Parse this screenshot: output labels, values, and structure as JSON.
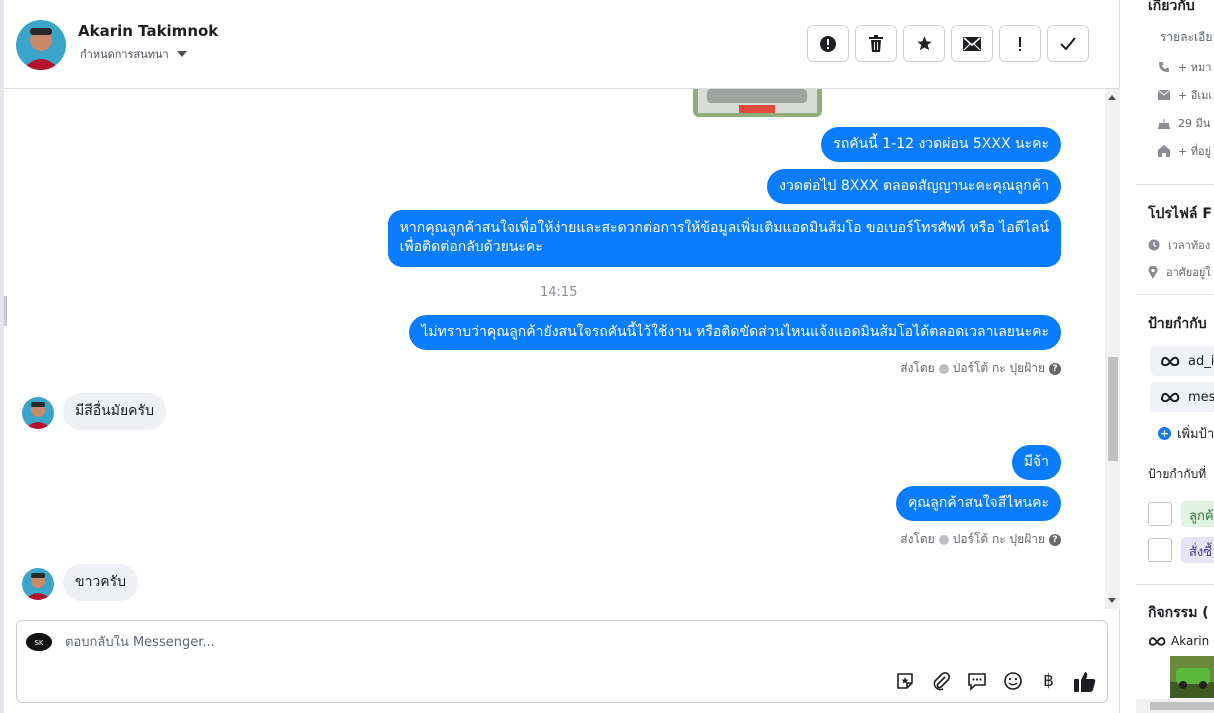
{
  "header": {
    "contact_name": "Akarin Takimnok",
    "assign_label": "กำหนดการสนทนา",
    "actions": [
      {
        "name": "report-button",
        "glyph": "!",
        "icon": "alert-circle-icon"
      },
      {
        "name": "delete-button",
        "glyph": "🗑",
        "icon": "trash-icon"
      },
      {
        "name": "star-button",
        "glyph": "★",
        "icon": "star-icon"
      },
      {
        "name": "mark-unread-button",
        "glyph": "✉",
        "icon": "envelope-icon"
      },
      {
        "name": "spam-button",
        "glyph": "!",
        "icon": "exclamation-icon"
      },
      {
        "name": "mark-done-button",
        "glyph": "✓",
        "icon": "check-icon"
      }
    ]
  },
  "messages": {
    "out_1": "รถคันนี้ 1-12 งวดผ่อน 5XXX นะคะ",
    "out_2": "งวดต่อไป 8XXX ตลอดสัญญานะคะคุณลูกค้า",
    "out_3_line1": "หากคุณลูกค้าสนใจเพื่อให้ง่ายและสะดวกต่อการให้ข้อมูลเพิ่มเติมแอดมินส้มโอ ขอเบอร์โทรศัพท์ หรือ ไอดีไลน์",
    "out_3_line2": "เพื่อติดต่อกลับด้วยนะคะ",
    "time": "14:15",
    "out_4": "ไม่ทราบว่าคุณลูกค้ายังสนใจรถคันนี้ไว้ใช้งาน หรือติดขัดส่วนไหนแจ้งแอดมินส้มโอได้ตลอดเวลาเลยนะคะ",
    "sent_by_label": "ส่งโดย",
    "sent_by_name": "ปอร์โต้ กะ ปุยฝ้าย",
    "in_1": "มีสีอื่นมัยครับ",
    "out_5": "มีจ้า",
    "out_6": "คุณลูกค้าสนใจสีไหนคะ",
    "in_2": "ขาวครับ"
  },
  "composer": {
    "placeholder": "ตอบกลับใน Messenger...",
    "tools": [
      "sticker-icon",
      "attachment-icon",
      "saved-reply-icon",
      "emoji-icon",
      "baht-icon",
      "like-icon"
    ],
    "baht_glyph": "฿"
  },
  "side": {
    "about_title": "เกี่ยวกับ",
    "details_label": "รายละเอีย",
    "add_phone": "+ หมา",
    "add_email": "+ อีเมเ",
    "birthday": "29 มีน",
    "add_address": "+ ที่อยู่",
    "profile_title": "โปรไฟล์ F",
    "local_time": "เวลาท้อง",
    "lives_in": "อาศัยอยู่ใ",
    "tags_title": "ป้ายกำกับ",
    "tag_1": "ad_io",
    "tag_2": "mess",
    "add_tag": "เพิ่มป้า",
    "labels_title": "ป้ายกำกับที่",
    "label_1": "ลูกค้",
    "label_2": "สั่งซื้",
    "activity_title": "กิจกรรม (",
    "activity_name": "Akarin"
  },
  "colors": {
    "outgoing_bubble": "#0a7cff",
    "incoming_bubble": "#eef0f3",
    "label_green_bg": "#e3f3e3",
    "label_purple_bg": "#e7e3f7"
  }
}
